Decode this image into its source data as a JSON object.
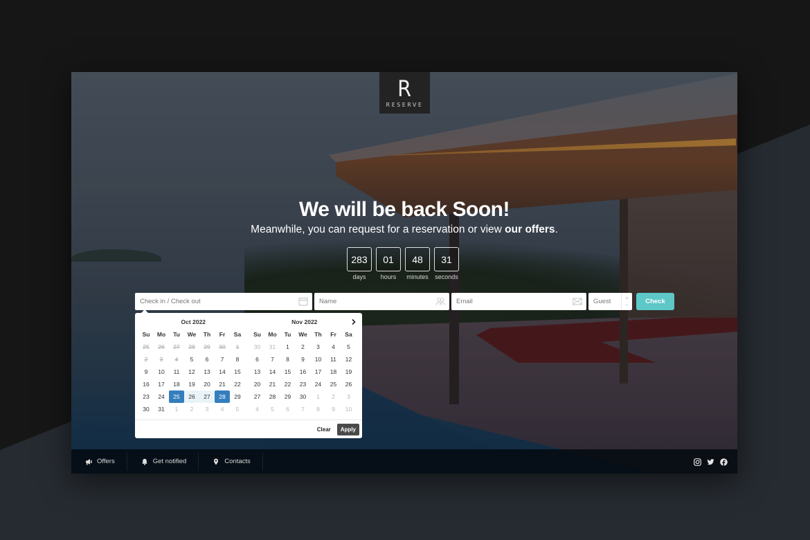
{
  "brand": {
    "logo_mark": "R",
    "logo_text": "RESERVE"
  },
  "hero": {
    "title": "We will be back Soon!",
    "subtitle_prefix": "Meanwhile, you can request for a reservation or view ",
    "subtitle_link": "our offers",
    "subtitle_suffix": "."
  },
  "countdown": [
    {
      "value": "283",
      "label": "days"
    },
    {
      "value": "01",
      "label": "hours"
    },
    {
      "value": "48",
      "label": "minutes"
    },
    {
      "value": "31",
      "label": "seconds"
    }
  ],
  "form": {
    "dates": {
      "placeholder": "Check in / Check out",
      "icon": "calendar-icon"
    },
    "name": {
      "placeholder": "Name",
      "icon": "users-icon"
    },
    "email": {
      "placeholder": "Email",
      "icon": "envelope-icon"
    },
    "guest": {
      "placeholder": "Guest",
      "plus": "+",
      "minus": "−"
    },
    "submit_label": "Check",
    "accent_color": "#5ec7c8"
  },
  "calendar": {
    "weekdays": [
      "Su",
      "Mo",
      "Tu",
      "We",
      "Th",
      "Fr",
      "Sa"
    ],
    "next_label": "›",
    "selection_color": "#357ebd",
    "months": [
      {
        "title": "Oct 2022",
        "days": [
          {
            "d": "25",
            "s": "disabled"
          },
          {
            "d": "26",
            "s": "disabled"
          },
          {
            "d": "27",
            "s": "disabled"
          },
          {
            "d": "28",
            "s": "disabled"
          },
          {
            "d": "29",
            "s": "disabled"
          },
          {
            "d": "30",
            "s": "disabled"
          },
          {
            "d": "1",
            "s": "disabled"
          },
          {
            "d": "2",
            "s": "disabled"
          },
          {
            "d": "3",
            "s": "disabled"
          },
          {
            "d": "4",
            "s": "disabled"
          },
          {
            "d": "5",
            "s": ""
          },
          {
            "d": "6",
            "s": ""
          },
          {
            "d": "7",
            "s": ""
          },
          {
            "d": "8",
            "s": ""
          },
          {
            "d": "9",
            "s": ""
          },
          {
            "d": "10",
            "s": ""
          },
          {
            "d": "11",
            "s": ""
          },
          {
            "d": "12",
            "s": ""
          },
          {
            "d": "13",
            "s": ""
          },
          {
            "d": "14",
            "s": ""
          },
          {
            "d": "15",
            "s": ""
          },
          {
            "d": "16",
            "s": ""
          },
          {
            "d": "17",
            "s": ""
          },
          {
            "d": "18",
            "s": ""
          },
          {
            "d": "19",
            "s": ""
          },
          {
            "d": "20",
            "s": ""
          },
          {
            "d": "21",
            "s": ""
          },
          {
            "d": "22",
            "s": ""
          },
          {
            "d": "23",
            "s": ""
          },
          {
            "d": "24",
            "s": ""
          },
          {
            "d": "25",
            "s": "sel"
          },
          {
            "d": "26",
            "s": "inrange"
          },
          {
            "d": "27",
            "s": "inrange"
          },
          {
            "d": "28",
            "s": "sel"
          },
          {
            "d": "29",
            "s": ""
          },
          {
            "d": "30",
            "s": ""
          },
          {
            "d": "31",
            "s": ""
          },
          {
            "d": "1",
            "s": "off"
          },
          {
            "d": "2",
            "s": "off"
          },
          {
            "d": "3",
            "s": "off"
          },
          {
            "d": "4",
            "s": "off"
          },
          {
            "d": "5",
            "s": "off"
          }
        ]
      },
      {
        "title": "Nov 2022",
        "days": [
          {
            "d": "30",
            "s": "off"
          },
          {
            "d": "31",
            "s": "off"
          },
          {
            "d": "1",
            "s": ""
          },
          {
            "d": "2",
            "s": ""
          },
          {
            "d": "3",
            "s": ""
          },
          {
            "d": "4",
            "s": ""
          },
          {
            "d": "5",
            "s": ""
          },
          {
            "d": "6",
            "s": ""
          },
          {
            "d": "7",
            "s": ""
          },
          {
            "d": "8",
            "s": ""
          },
          {
            "d": "9",
            "s": ""
          },
          {
            "d": "10",
            "s": ""
          },
          {
            "d": "11",
            "s": ""
          },
          {
            "d": "12",
            "s": ""
          },
          {
            "d": "13",
            "s": ""
          },
          {
            "d": "14",
            "s": ""
          },
          {
            "d": "15",
            "s": ""
          },
          {
            "d": "16",
            "s": ""
          },
          {
            "d": "17",
            "s": ""
          },
          {
            "d": "18",
            "s": ""
          },
          {
            "d": "19",
            "s": ""
          },
          {
            "d": "20",
            "s": ""
          },
          {
            "d": "21",
            "s": ""
          },
          {
            "d": "22",
            "s": ""
          },
          {
            "d": "23",
            "s": ""
          },
          {
            "d": "24",
            "s": ""
          },
          {
            "d": "25",
            "s": ""
          },
          {
            "d": "26",
            "s": ""
          },
          {
            "d": "27",
            "s": ""
          },
          {
            "d": "28",
            "s": ""
          },
          {
            "d": "29",
            "s": ""
          },
          {
            "d": "30",
            "s": ""
          },
          {
            "d": "1",
            "s": "off"
          },
          {
            "d": "2",
            "s": "off"
          },
          {
            "d": "3",
            "s": "off"
          },
          {
            "d": "4",
            "s": "off"
          },
          {
            "d": "5",
            "s": "off"
          },
          {
            "d": "6",
            "s": "off"
          },
          {
            "d": "7",
            "s": "off"
          },
          {
            "d": "8",
            "s": "off"
          },
          {
            "d": "9",
            "s": "off"
          },
          {
            "d": "10",
            "s": "off"
          }
        ]
      }
    ],
    "clear_label": "Clear",
    "apply_label": "Apply"
  },
  "footer": {
    "links": [
      {
        "label": "Offers",
        "icon": "megaphone-icon"
      },
      {
        "label": "Get notified",
        "icon": "bell-icon"
      },
      {
        "label": "Contacts",
        "icon": "map-pin-icon"
      }
    ],
    "social": [
      "instagram-icon",
      "twitter-icon",
      "facebook-icon"
    ]
  }
}
